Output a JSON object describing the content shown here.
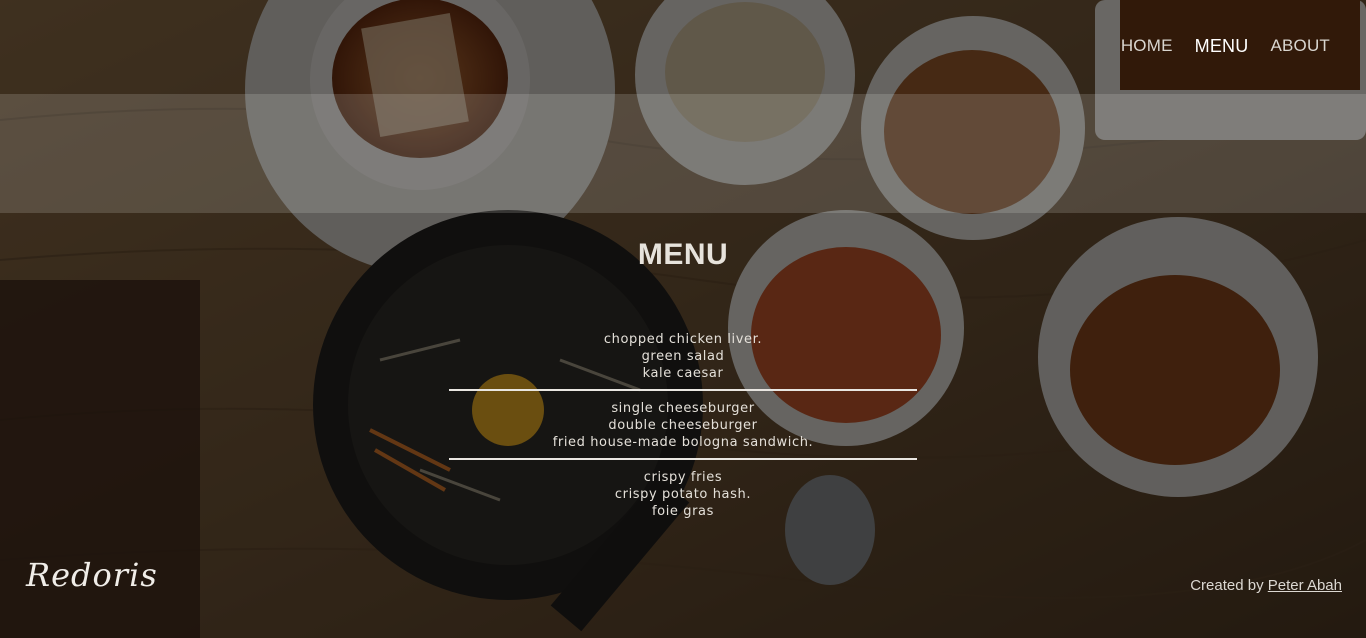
{
  "nav": {
    "items": [
      {
        "label": "HOME",
        "active": false
      },
      {
        "label": "MENU",
        "active": true
      },
      {
        "label": "ABOUT",
        "active": false
      }
    ]
  },
  "menu": {
    "title": "MENU",
    "groups": [
      {
        "items": [
          "chopped chicken liver.",
          "green salad",
          "kale caesar"
        ]
      },
      {
        "items": [
          "single cheeseburger",
          "double cheeseburger",
          "fried house-made bologna sandwich."
        ]
      },
      {
        "items": [
          "crispy fries",
          "crispy potato hash.",
          "foie gras"
        ]
      }
    ]
  },
  "footer": {
    "logo": "Redoris",
    "credit_prefix": "Created by",
    "credit_author": "Peter Abah"
  },
  "colors": {
    "overlay": "#0e0c0a",
    "text": "#e8e4de",
    "divider": "#e9e6e1"
  }
}
